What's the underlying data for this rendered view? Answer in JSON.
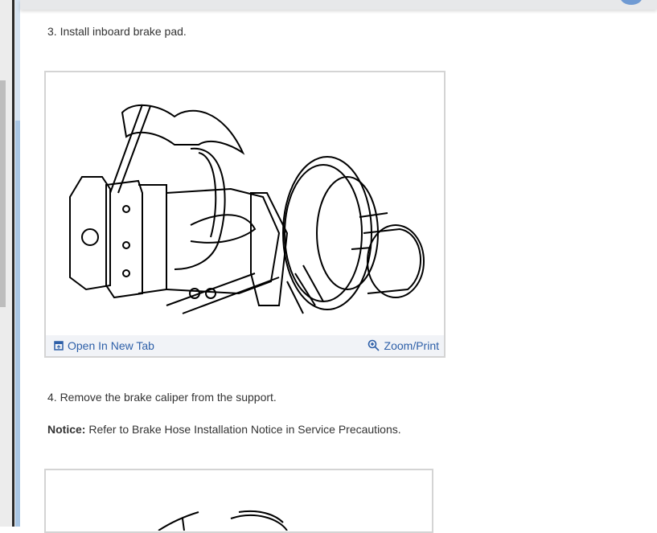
{
  "steps": [
    {
      "text": "3. Install inboard brake pad."
    },
    {
      "text": "4. Remove the brake caliper from the support."
    }
  ],
  "notice": {
    "label": "Notice:",
    "text": " Refer to Brake Hose Installation Notice in Service Precautions."
  },
  "figure": {
    "open_label": "Open In New Tab",
    "zoom_label": "Zoom/Print",
    "open_icon": "open-new-tab-icon",
    "zoom_icon": "zoom-in-icon"
  }
}
